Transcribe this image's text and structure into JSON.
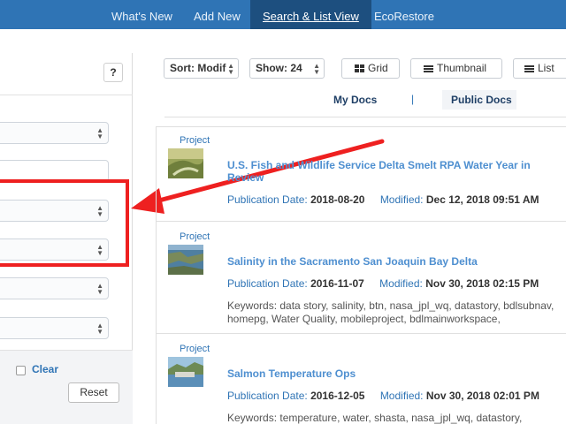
{
  "nav": {
    "tabs": [
      "What's New",
      "Add New",
      "Search & List View",
      "EcoRestore"
    ],
    "active": "Search & List View"
  },
  "left_panel": {
    "help_label": "?",
    "clear_label": "Clear",
    "reset_label": "Reset"
  },
  "toolbar": {
    "sort_label": "Sort: Modif",
    "show_label": "Show: 24",
    "grid_label": "Grid",
    "thumbnail_label": "Thumbnail",
    "list_label": "List"
  },
  "doc_tabs": {
    "my_docs": "My Docs",
    "separator": "|",
    "public_docs": "Public Docs"
  },
  "labels": {
    "pub_date": "Publication Date:",
    "modified": "Modified:",
    "keywords_prefix": "Keywords:"
  },
  "results": [
    {
      "type": "Project",
      "title": "U.S. Fish and Wildlife Service Delta Smelt RPA Water Year in Review",
      "pub_date": "2018-08-20",
      "modified": "Dec 12, 2018 09:51 AM",
      "keywords": ""
    },
    {
      "type": "Project",
      "title": "Salinity in the Sacramento San Joaquin Bay Delta",
      "pub_date": "2016-11-07",
      "modified": "Nov 30, 2018 02:15 PM",
      "keywords": "data story, salinity, btn, nasa_jpl_wq, datastory, bdlsubnav, homepg, Water Quality, mobileproject, bdlmainworkspace,"
    },
    {
      "type": "Project",
      "title": "Salmon Temperature Ops",
      "pub_date": "2016-12-05",
      "modified": "Nov 30, 2018 02:01 PM",
      "keywords": "temperature, water, shasta, nasa_jpl_wq, datastory,"
    }
  ],
  "colors": {
    "nav_bg": "#2f74b5",
    "nav_active": "#1d4f7f",
    "link": "#2f74b5",
    "highlight": "#ee2020"
  }
}
